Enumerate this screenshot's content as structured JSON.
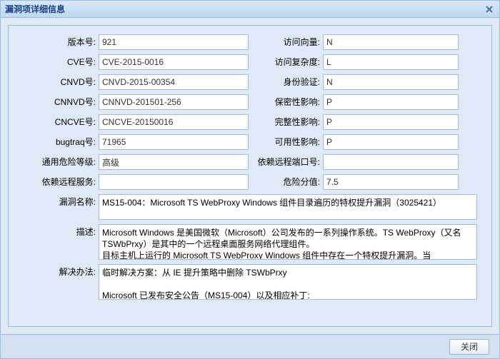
{
  "window": {
    "title": "漏洞项详细信息"
  },
  "left": {
    "version_label": "版本号:",
    "version": "921",
    "cve_label": "CVE号:",
    "cve": "CVE-2015-0016",
    "cnvd_label": "CNVD号:",
    "cnvd": "CNVD-2015-00354",
    "cnnvd_label": "CNNVD号:",
    "cnnvd": "CNNVD-201501-256",
    "cncve_label": "CNCVE号:",
    "cncve": "CNCVE-20150016",
    "bugtraq_label": "bugtraq号:",
    "bugtraq": "71965",
    "risk_label": "通用危险等级:",
    "risk": "高级",
    "remote_svc_label": "依赖远程服务:",
    "remote_svc": ""
  },
  "right": {
    "av_label": "访问向量:",
    "av": "N",
    "ac_label": "访问复杂度:",
    "ac": "L",
    "au_label": "身份验证:",
    "au": "N",
    "ci_label": "保密性影响:",
    "ci": "P",
    "ii_label": "完整性影响:",
    "ii": "P",
    "ai_label": "可用性影响:",
    "ai": "P",
    "port_label": "依赖远程端口号:",
    "port": "",
    "score_label": "危险分值:",
    "score": "7.5"
  },
  "name_label": "漏洞名称:",
  "name": "MS15-004：Microsoft TS WebProxy Windows 组件目录遍历的特权提升漏洞（3025421）",
  "desc_label": "描述:",
  "desc": "Microsoft Windows 是美国微软（Microsoft）公司发布的一系列操作系统。TS WebProxy（又名 TSWbPrxy）是其中的一个远程桌面服务网络代理组件。\n目标主机上运行的 Microsoft TS WebProxy Windows 组件中存在一个特权提升漏洞。当",
  "fix_label": "解决办法:",
  "fix": "临时解决方案：从 IE 提升策略中删除 TSWbPrxy\n\nMicrosoft 已发布安全公告（MS15-004）以及相应补丁:",
  "footer": {
    "close": "关闭"
  }
}
